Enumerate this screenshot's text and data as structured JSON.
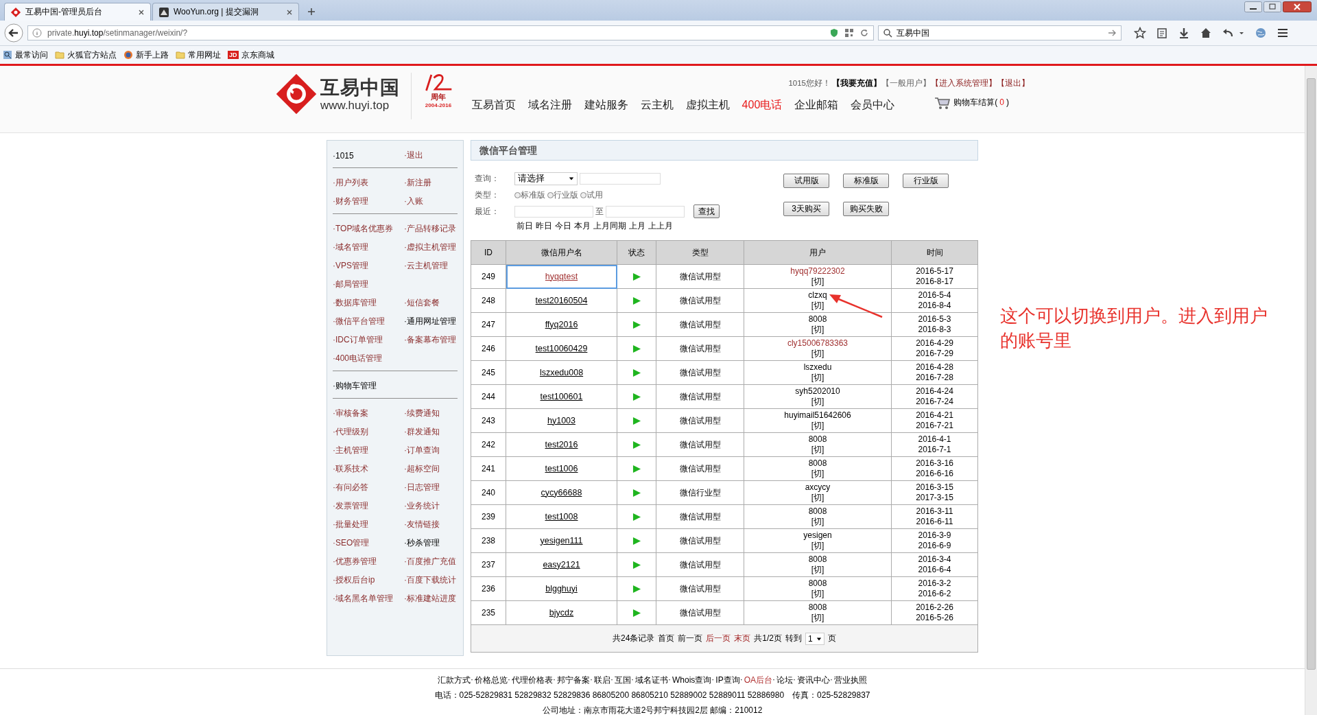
{
  "browser": {
    "tabs": [
      {
        "title": "互易中国-管理员后台",
        "selected": true,
        "kind": "logo"
      },
      {
        "title": "WooYun.org | 提交漏洞",
        "selected": false,
        "kind": "site"
      }
    ],
    "url": "private.**huyi.top**/setinmanager/weixin/?",
    "search": "互易中国",
    "bookmarks": [
      {
        "label": "最常访问",
        "kind": "search"
      },
      {
        "label": "火狐官方站点",
        "kind": "folder"
      },
      {
        "label": "新手上路",
        "kind": "browser"
      },
      {
        "label": "常用网址",
        "kind": "folder"
      },
      {
        "label": "京东商城",
        "kind": "badge",
        "badge": "JD"
      }
    ]
  },
  "header": {
    "logo_name": "互易中国",
    "logo_url": "www.huyi.top",
    "anniversary": "周年",
    "anniversary_years": "2004-2016",
    "greeting": "1015您好！",
    "user_links": [
      {
        "label": "【我要充值】",
        "kind": "strong"
      },
      {
        "label": "【一般用户】",
        "kind": "muted"
      },
      {
        "label": "【进入系统管理】",
        "kind": "alert"
      },
      {
        "label": "【退出】",
        "kind": "alert"
      }
    ],
    "nav": [
      {
        "label": "互易首页",
        "highlight": false
      },
      {
        "label": "域名注册",
        "highlight": false
      },
      {
        "label": "建站服务",
        "highlight": false
      },
      {
        "label": "云主机",
        "highlight": false
      },
      {
        "label": "虚拟主机",
        "highlight": false
      },
      {
        "label": "400电话",
        "highlight": true
      },
      {
        "label": "企业邮箱",
        "highlight": false
      },
      {
        "label": "会员中心",
        "highlight": false
      }
    ],
    "cart": {
      "label": "购物车结算(",
      "count": "0",
      "close": ")"
    }
  },
  "sidebar": {
    "sections": [
      {
        "rows": [
          [
            {
              "label": "·1015",
              "current": true
            },
            {
              "label": "·退出",
              "current": false
            }
          ]
        ]
      },
      {
        "rows": [
          [
            {
              "label": "·用户列表",
              "current": false
            },
            {
              "label": "·新注册",
              "current": false
            }
          ],
          [
            {
              "label": "·财务管理",
              "current": false
            },
            {
              "label": "·入账",
              "current": false
            }
          ]
        ]
      },
      {
        "rows": [
          [
            {
              "label": "·TOP域名优惠券",
              "current": false
            },
            {
              "label": "·产品转移记录",
              "current": false
            }
          ],
          [
            {
              "label": "·域名管理",
              "current": false
            },
            {
              "label": "·虚拟主机管理",
              "current": false
            }
          ],
          [
            {
              "label": "·VPS管理",
              "current": false
            },
            {
              "label": "·云主机管理",
              "current": false
            }
          ],
          [
            {
              "label": "·邮局管理",
              "current": false
            }
          ],
          [
            {
              "label": "·数据库管理",
              "current": false
            },
            {
              "label": "·短信套餐",
              "current": false
            }
          ],
          [
            {
              "label": "·微信平台管理",
              "current": false
            },
            {
              "label": "·通用网址管理",
              "current": true
            }
          ],
          [
            {
              "label": "·IDC订单管理",
              "current": false
            },
            {
              "label": "·备案幕布管理",
              "current": false
            }
          ],
          [
            {
              "label": "·400电话管理",
              "current": false
            }
          ]
        ]
      },
      {
        "rows": [
          [
            {
              "label": "·购物车管理",
              "current": true
            }
          ]
        ]
      },
      {
        "rows": [
          [
            {
              "label": "·审核备案",
              "current": false
            },
            {
              "label": "·续费通知",
              "current": false
            }
          ],
          [
            {
              "label": "·代理级别",
              "current": false
            },
            {
              "label": "·群发通知",
              "current": false
            }
          ],
          [
            {
              "label": "·主机管理",
              "current": false
            },
            {
              "label": "·订单查询",
              "current": false
            }
          ],
          [
            {
              "label": "·联系技术",
              "current": false
            },
            {
              "label": "·超标空间",
              "current": false
            }
          ],
          [
            {
              "label": "·有问必答",
              "current": false
            },
            {
              "label": "·日志管理",
              "current": false
            }
          ],
          [
            {
              "label": "·发票管理",
              "current": false
            },
            {
              "label": "·业务统计",
              "current": false
            }
          ],
          [
            {
              "label": "·批量处理",
              "current": false
            },
            {
              "label": "·友情链接",
              "current": false
            }
          ],
          [
            {
              "label": "·SEO管理",
              "current": false
            },
            {
              "label": "·秒杀管理",
              "current": true
            }
          ],
          [
            {
              "label": "·优惠券管理",
              "current": false
            },
            {
              "label": "·百度推广充值",
              "current": false
            }
          ],
          [
            {
              "label": "·授权后台ip",
              "current": false
            },
            {
              "label": "·百度下载统计",
              "current": false
            }
          ],
          [
            {
              "label": "·域名黑名单管理",
              "current": false
            },
            {
              "label": "·标准建站进度",
              "current": false
            }
          ]
        ]
      }
    ]
  },
  "panel": {
    "title": "微信平台管理",
    "query": {
      "label": "查询：",
      "select": "请选择",
      "type_label": "类型：",
      "types": [
        {
          "label": "标准版",
          "selected": false
        },
        {
          "label": "行业版",
          "selected": false
        },
        {
          "label": "试用",
          "selected": false
        }
      ],
      "recent_label": "最近：",
      "to": "至",
      "find": "查找",
      "quick_dates": [
        "前日",
        "昨日",
        "今日",
        "本月",
        "上月同期",
        "上月",
        "上上月"
      ]
    },
    "buttons": [
      [
        "试用版",
        "标准版",
        "行业版"
      ],
      [
        "3天购买",
        "购买失败"
      ]
    ],
    "table": {
      "columns": [
        "ID",
        "微信用户名",
        "状态",
        "类型",
        "用户",
        "时间"
      ],
      "rows": [
        {
          "id": "249",
          "name": "hyqqtest",
          "focused": true,
          "type": "微信试用型",
          "user": "hyqq79222302",
          "highlight": true,
          "switch": "[切]",
          "start": "2016-5-17",
          "end": "2016-8-17"
        },
        {
          "id": "248",
          "name": "test20160504",
          "focused": false,
          "type": "微信试用型",
          "user": "clzxq",
          "highlight": false,
          "switch": "[切]",
          "start": "2016-5-4",
          "end": "2016-8-4"
        },
        {
          "id": "247",
          "name": "ffyq2016",
          "focused": false,
          "type": "微信试用型",
          "user": "8008",
          "highlight": false,
          "switch": "[切]",
          "start": "2016-5-3",
          "end": "2016-8-3"
        },
        {
          "id": "246",
          "name": "test10060429",
          "focused": false,
          "type": "微信试用型",
          "user": "cly15006783363",
          "highlight": true,
          "switch": "[切]",
          "start": "2016-4-29",
          "end": "2016-7-29"
        },
        {
          "id": "245",
          "name": "lszxedu008",
          "focused": false,
          "type": "微信试用型",
          "user": "lszxedu",
          "highlight": false,
          "switch": "[切]",
          "start": "2016-4-28",
          "end": "2016-7-28"
        },
        {
          "id": "244",
          "name": "test100601",
          "focused": false,
          "type": "微信试用型",
          "user": "syh5202010",
          "highlight": false,
          "switch": "[切]",
          "start": "2016-4-24",
          "end": "2016-7-24"
        },
        {
          "id": "243",
          "name": "hy1003",
          "focused": false,
          "type": "微信试用型",
          "user": "huyimail51642606",
          "highlight": false,
          "switch": "[切]",
          "start": "2016-4-21",
          "end": "2016-7-21"
        },
        {
          "id": "242",
          "name": "test2016",
          "focused": false,
          "type": "微信试用型",
          "user": "8008",
          "highlight": false,
          "switch": "[切]",
          "start": "2016-4-1",
          "end": "2016-7-1"
        },
        {
          "id": "241",
          "name": "test1006",
          "focused": false,
          "type": "微信试用型",
          "user": "8008",
          "highlight": false,
          "switch": "[切]",
          "start": "2016-3-16",
          "end": "2016-6-16"
        },
        {
          "id": "240",
          "name": "cycy66688",
          "focused": false,
          "type": "微信行业型",
          "user": "axcycy",
          "highlight": false,
          "switch": "[切]",
          "start": "2016-3-15",
          "end": "2017-3-15"
        },
        {
          "id": "239",
          "name": "test1008",
          "focused": false,
          "type": "微信试用型",
          "user": "8008",
          "highlight": false,
          "switch": "[切]",
          "start": "2016-3-11",
          "end": "2016-6-11"
        },
        {
          "id": "238",
          "name": "yesigen111",
          "focused": false,
          "type": "微信试用型",
          "user": "yesigen",
          "highlight": false,
          "switch": "[切]",
          "start": "2016-3-9",
          "end": "2016-6-9"
        },
        {
          "id": "237",
          "name": "easy2121",
          "focused": false,
          "type": "微信试用型",
          "user": "8008",
          "highlight": false,
          "switch": "[切]",
          "start": "2016-3-4",
          "end": "2016-6-4"
        },
        {
          "id": "236",
          "name": "blgghuyi",
          "focused": false,
          "type": "微信试用型",
          "user": "8008",
          "highlight": false,
          "switch": "[切]",
          "start": "2016-3-2",
          "end": "2016-6-2"
        },
        {
          "id": "235",
          "name": "bjycdz",
          "focused": false,
          "type": "微信试用型",
          "user": "8008",
          "highlight": false,
          "switch": "[切]",
          "start": "2016-2-26",
          "end": "2016-5-26"
        }
      ]
    },
    "pager": {
      "items": [
        {
          "label": "共24条记录",
          "active": false
        },
        {
          "label": "首页",
          "active": false
        },
        {
          "label": "前一页",
          "active": false
        },
        {
          "label": "后一页",
          "active": true
        },
        {
          "label": "末页",
          "active": true
        },
        {
          "label": "共1/2页",
          "active": false
        },
        {
          "label": "转到",
          "active": false
        }
      ],
      "page": "1",
      "suffix": "页"
    }
  },
  "footer": {
    "links": [
      {
        "label": "汇款方式",
        "active": false
      },
      {
        "label": "价格总览",
        "active": false
      },
      {
        "label": "代理价格表",
        "active": false
      },
      {
        "label": "邦宁备案",
        "active": false
      },
      {
        "label": "联启",
        "active": false
      },
      {
        "label": "互国",
        "active": false
      },
      {
        "label": "域名证书",
        "active": false
      },
      {
        "label": "Whois查询",
        "active": false
      },
      {
        "label": "IP查询",
        "active": false
      },
      {
        "label": "OA后台",
        "active": true
      },
      {
        "label": "论坛",
        "active": false
      },
      {
        "label": "资讯中心",
        "active": false
      },
      {
        "label": "营业执照",
        "active": false
      }
    ],
    "separator": "·",
    "phone": "电话：025-52829831 52829832 52829836 86805200 86805210 52889002 52889011 52886980　传真：025-52829837",
    "address": "公司地址：南京市雨花大道2号邦宁科技园2层 邮编：210012"
  },
  "annotation": {
    "text": "这个可以切换到用户。进入到用户的账号里"
  }
}
